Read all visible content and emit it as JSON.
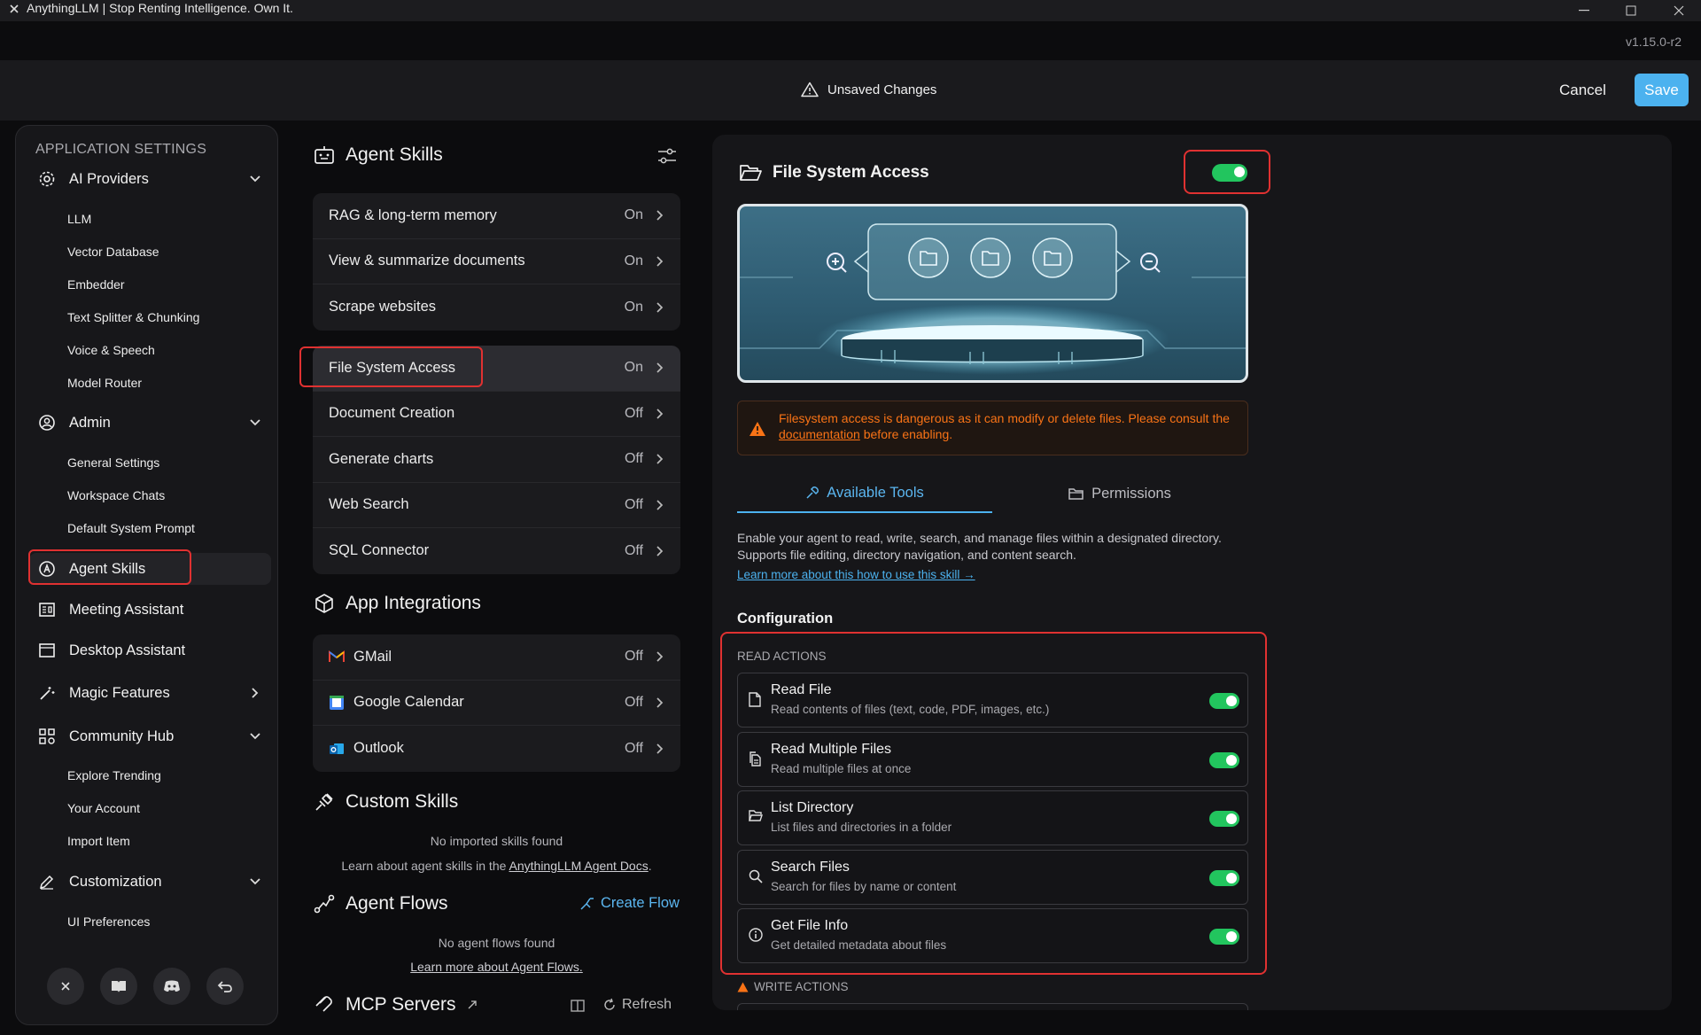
{
  "window": {
    "title": "AnythingLLM | Stop Renting Intelligence. Own It.",
    "version": "v1.15.0-r2"
  },
  "unsaved": {
    "text": "Unsaved Changes",
    "cancel_label": "Cancel",
    "save_label": "Save"
  },
  "sidebar": {
    "heading": "APPLICATION SETTINGS",
    "ai_providers": {
      "label": "AI Providers",
      "items": [
        "LLM",
        "Vector Database",
        "Embedder",
        "Text Splitter & Chunking",
        "Voice & Speech",
        "Model Router"
      ]
    },
    "admin": {
      "label": "Admin",
      "items": [
        "General Settings",
        "Workspace Chats",
        "Default System Prompt"
      ]
    },
    "agent_skills": "Agent Skills",
    "meeting_assistant": "Meeting Assistant",
    "desktop_assistant": "Desktop Assistant",
    "magic_features": "Magic Features",
    "community_hub": {
      "label": "Community Hub",
      "items": [
        "Explore Trending",
        "Your Account",
        "Import Item"
      ]
    },
    "customization": {
      "label": "Customization",
      "items": [
        "UI Preferences"
      ]
    }
  },
  "skills": {
    "title": "Agent Skills",
    "default_group": [
      {
        "label": "RAG & long-term memory",
        "state": "On"
      },
      {
        "label": "View & summarize documents",
        "state": "On"
      },
      {
        "label": "Scrape websites",
        "state": "On"
      }
    ],
    "config_group": [
      {
        "label": "File System Access",
        "state": "On"
      },
      {
        "label": "Document Creation",
        "state": "Off"
      },
      {
        "label": "Generate charts",
        "state": "Off"
      },
      {
        "label": "Web Search",
        "state": "Off"
      },
      {
        "label": "SQL Connector",
        "state": "Off"
      }
    ]
  },
  "integrations": {
    "title": "App Integrations",
    "items": [
      {
        "label": "GMail",
        "state": "Off"
      },
      {
        "label": "Google Calendar",
        "state": "Off"
      },
      {
        "label": "Outlook",
        "state": "Off"
      }
    ]
  },
  "custom_skills": {
    "title": "Custom Skills",
    "empty": "No imported skills found",
    "learn_prefix": "Learn about agent skills in the",
    "learn_link": "AnythingLLM Agent Docs",
    "learn_suffix": "."
  },
  "agent_flows": {
    "title": "Agent Flows",
    "create_label": "Create Flow",
    "empty": "No agent flows found",
    "learn_link": "Learn more about Agent Flows."
  },
  "mcp": {
    "title": "MCP Servers",
    "refresh_label": "Refresh"
  },
  "panel": {
    "title": "File System Access",
    "enabled": true,
    "warning_prefix": "Filesystem access is dangerous as it can modify or delete files. Please consult the",
    "warning_link": "documentation",
    "warning_suffix": "before enabling.",
    "tabs": {
      "available": "Available Tools",
      "permissions": "Permissions"
    },
    "description": "Enable your agent to read, write, search, and manage files within a designated directory. Supports file editing, directory navigation, and content search.",
    "learn_more": "Learn more about this how to use this skill →",
    "config_heading": "Configuration",
    "read_actions_heading": "READ ACTIONS",
    "read_tools": [
      {
        "name": "Read File",
        "desc": "Read contents of files (text, code, PDF, images, etc.)",
        "enabled": true
      },
      {
        "name": "Read Multiple Files",
        "desc": "Read multiple files at once",
        "enabled": true
      },
      {
        "name": "List Directory",
        "desc": "List files and directories in a folder",
        "enabled": true
      },
      {
        "name": "Search Files",
        "desc": "Search for files by name or content",
        "enabled": true
      },
      {
        "name": "Get File Info",
        "desc": "Get detailed metadata about files",
        "enabled": true
      }
    ],
    "write_actions_heading": "WRITE ACTIONS"
  },
  "colors": {
    "accent": "#4cb2ef",
    "toggle_on": "#22c55e",
    "highlight": "#e03131",
    "warning": "#f97316"
  }
}
